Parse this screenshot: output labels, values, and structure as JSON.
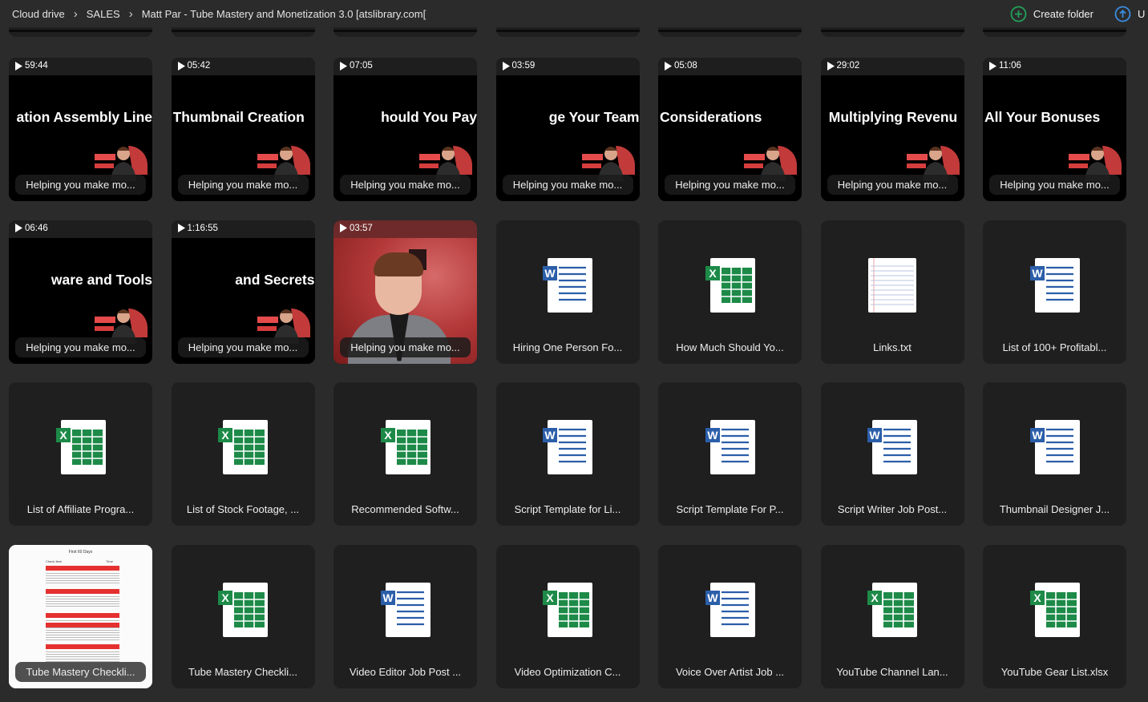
{
  "breadcrumb": [
    "Cloud drive",
    "SALES",
    "Matt Par - Tube Mastery and Monetization 3.0 [atslibrary.com["
  ],
  "actions": {
    "create_folder": "Create folder",
    "upload_glyph": "U"
  },
  "colors": {
    "accent": "#22a05b",
    "word_blue": "#2b5ea9",
    "excel_green": "#1d8a48"
  },
  "items": [
    {
      "type": "video",
      "duration": "59:44",
      "title": "ation Assembly Line",
      "label": "Helping you make mo..."
    },
    {
      "type": "video",
      "duration": "05:42",
      "title": "Thumbnail Creation",
      "label": "Helping you make mo..."
    },
    {
      "type": "video",
      "duration": "07:05",
      "title": "hould You Pay",
      "label": "Helping you make mo..."
    },
    {
      "type": "video",
      "duration": "03:59",
      "title": "ge Your Team",
      "label": "Helping you make mo..."
    },
    {
      "type": "video",
      "duration": "05:08",
      "title": "Considerations",
      "label": "Helping you make mo..."
    },
    {
      "type": "video",
      "duration": "29:02",
      "title": "Multiplying Revenu",
      "label": "Helping you make mo..."
    },
    {
      "type": "video",
      "duration": "11:06",
      "title": "All Your Bonuses",
      "label": "Helping you make mo..."
    },
    {
      "type": "video",
      "duration": "06:46",
      "title": "ware and Tools",
      "label": "Helping you make mo..."
    },
    {
      "type": "video",
      "duration": "1:16:55",
      "title": "and Secrets",
      "label": "Helping you make mo..."
    },
    {
      "type": "photo",
      "duration": "03:57",
      "label": "Helping you make mo..."
    },
    {
      "type": "word",
      "label": "Hiring One Person Fo..."
    },
    {
      "type": "excel",
      "label": "How Much Should Yo..."
    },
    {
      "type": "text",
      "label": "Links.txt"
    },
    {
      "type": "word",
      "label": "List of 100+ Profitabl..."
    },
    {
      "type": "excel",
      "label": "List of Affiliate Progra..."
    },
    {
      "type": "excel",
      "label": "List of Stock Footage, ..."
    },
    {
      "type": "excel",
      "label": "Recommended Softw..."
    },
    {
      "type": "word",
      "label": "Script Template for Li..."
    },
    {
      "type": "word",
      "label": "Script Template For P..."
    },
    {
      "type": "word",
      "label": "Script Writer Job Post..."
    },
    {
      "type": "word",
      "label": "Thumbnail Designer J..."
    },
    {
      "type": "checklist",
      "label": "Tube Mastery Checkli...",
      "preview_title": "First 60 Days",
      "preview_col1": "Check Item",
      "preview_col2": "Time"
    },
    {
      "type": "excel",
      "label": "Tube Mastery Checkli..."
    },
    {
      "type": "word",
      "label": "Video Editor Job Post ..."
    },
    {
      "type": "excel",
      "label": "Video Optimization C..."
    },
    {
      "type": "word",
      "label": "Voice Over Artist Job ..."
    },
    {
      "type": "excel",
      "label": "YouTube Channel Lan..."
    },
    {
      "type": "excel",
      "label": "YouTube Gear List.xlsx"
    }
  ]
}
